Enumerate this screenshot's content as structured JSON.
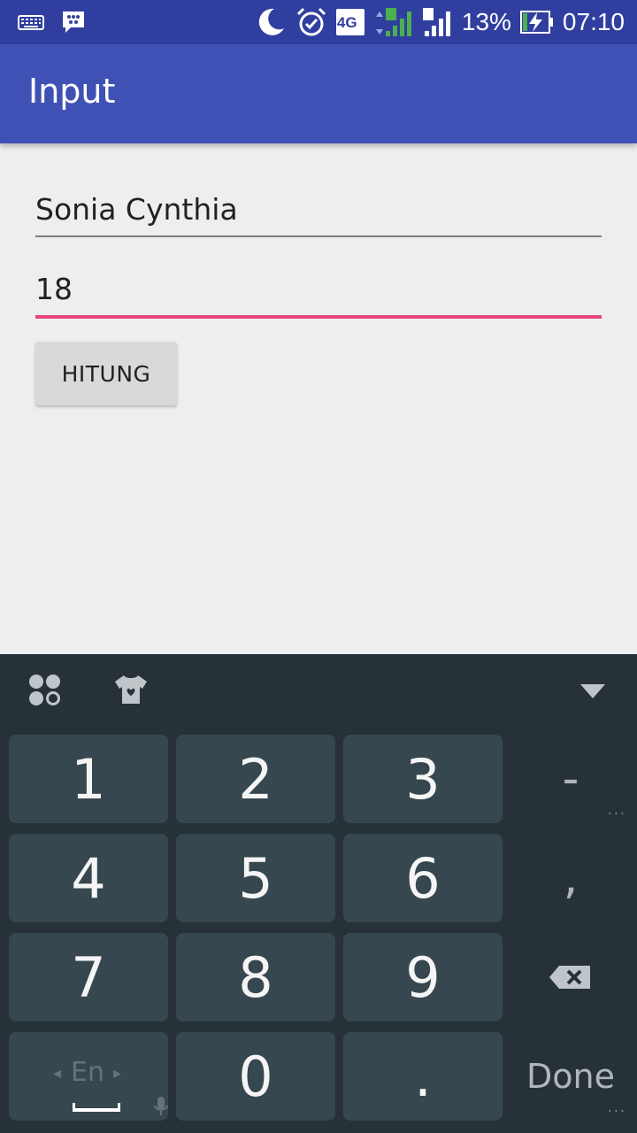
{
  "status_bar": {
    "network": "4G",
    "sim1": "1",
    "sim2": "2",
    "battery": "13%",
    "time": "07:10",
    "icons": [
      "keyboard-icon",
      "bbm-icon",
      "moon-icon",
      "alarm-icon",
      "network-4g-icon",
      "signal-sim1-icon",
      "signal-sim2-icon",
      "battery-charging-icon"
    ]
  },
  "app_bar": {
    "title": "Input"
  },
  "form": {
    "name_value": "Sonia Cynthia",
    "age_value": "18",
    "button_label": "HITUNG"
  },
  "keyboard": {
    "top_icons": [
      "apps-icon",
      "theme-shirt-icon",
      "hide-keyboard-icon"
    ],
    "keys": {
      "k1": "1",
      "k2": "2",
      "k3": "3",
      "k4": "4",
      "k5": "5",
      "k6": "6",
      "k7": "7",
      "k8": "8",
      "k9": "9",
      "k0": "0",
      "dot": ".",
      "minus": "-",
      "comma": ",",
      "done": "Done",
      "lang": "En",
      "more": "..."
    },
    "colors": {
      "background": "#263238",
      "key": "#37474f",
      "accent": "#e9467c"
    }
  }
}
